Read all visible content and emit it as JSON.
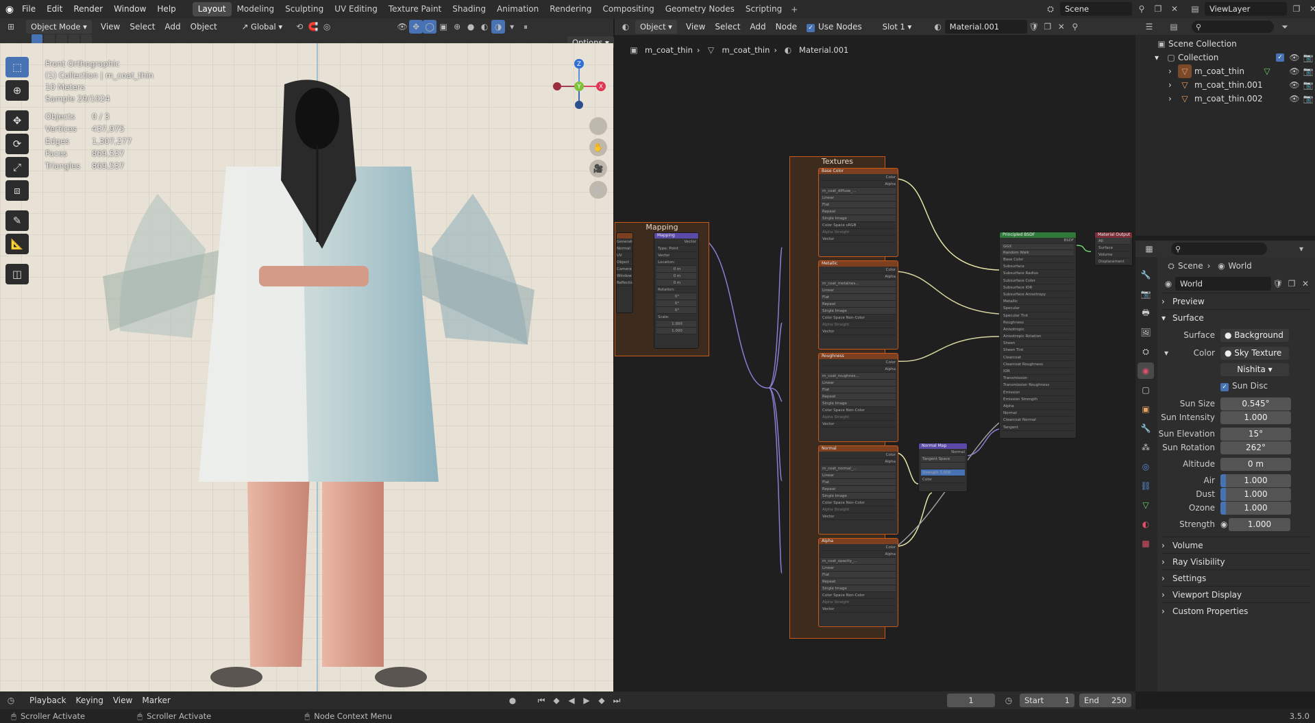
{
  "menu": [
    "File",
    "Edit",
    "Render",
    "Window",
    "Help"
  ],
  "workspaces": [
    "Layout",
    "Modeling",
    "Sculpting",
    "UV Editing",
    "Texture Paint",
    "Shading",
    "Animation",
    "Rendering",
    "Compositing",
    "Geometry Nodes",
    "Scripting"
  ],
  "active_workspace": "Layout",
  "scene_name": "Scene",
  "view_layer": "ViewLayer",
  "viewport_header": {
    "mode": "Object Mode",
    "menus": [
      "View",
      "Select",
      "Add",
      "Object"
    ],
    "transform": "Global",
    "options": "Options"
  },
  "viewport_overlay": {
    "view_name": "Front Orthographic",
    "collection": "(1) Collection | m_coat_thin",
    "scale": "10 Meters",
    "sample": "Sample 29/1024",
    "stats": [
      {
        "label": "Objects",
        "value": "0 / 3"
      },
      {
        "label": "Vertices",
        "value": "437,975"
      },
      {
        "label": "Edges",
        "value": "1,307,277"
      },
      {
        "label": "Faces",
        "value": "869,537"
      },
      {
        "label": "Triangles",
        "value": "869,537"
      }
    ]
  },
  "gizmo": {
    "z": "Z",
    "y": "Y",
    "x": "X"
  },
  "node_header": {
    "type": "Object",
    "menus": [
      "View",
      "Select",
      "Add",
      "Node"
    ],
    "use_nodes": "Use Nodes",
    "slot": "Slot 1",
    "material": "Material.001"
  },
  "breadcrumb": [
    "m_coat_thin",
    "m_coat_thin",
    "Material.001"
  ],
  "frames": {
    "textures": "Textures",
    "mapping": "Mapping"
  },
  "nodes": {
    "mapping": {
      "title": "Mapping",
      "type": "Type:",
      "type_value": "Point",
      "vector": "Vector",
      "location": "Location:",
      "rotation": "Rotation:",
      "scale": "Scale:",
      "loc": [
        "0 m",
        "0 m",
        "0 m"
      ],
      "rot": [
        "0°",
        "0°",
        "0°"
      ],
      "scl": [
        "1.000",
        "1.000",
        "1.000"
      ]
    },
    "texcoord_rows": [
      "Generated",
      "Normal",
      "UV",
      "Object",
      "Camera",
      "Window",
      "Reflection"
    ],
    "tex": [
      {
        "title": "Base Color",
        "image": "m_coat_diffuse_...",
        "space": "sRGB"
      },
      {
        "title": "Metallic",
        "image": "m_coat_metalnes...",
        "space": "Non-Color"
      },
      {
        "title": "Roughness",
        "image": "m_coat_roughnes...",
        "space": "Non-Color"
      },
      {
        "title": "Normal",
        "image": "m_coat_normal_...",
        "space": "Non-Color"
      },
      {
        "title": "Alpha",
        "image": "m_coat_opacity_...",
        "space": "Non-Color"
      }
    ],
    "tex_rows": [
      "Linear",
      "Flat",
      "Repeat",
      "Single Image"
    ],
    "tex_out": [
      "Color",
      "Alpha"
    ],
    "color_space": "Color Space",
    "alpha_label": "Alpha",
    "alpha_value": "Straight",
    "vector_label": "Vector",
    "bsdf": {
      "title": "Principled BSDF",
      "out": "BSDF",
      "dist": "GGX",
      "sss": "Random Walk",
      "rows": [
        "Base Color",
        "Subsurface",
        "Subsurface Radius",
        "Subsurface Color",
        "Subsurface IOR",
        "Subsurface Anisotropy",
        "Metallic",
        "Specular",
        "Specular Tint",
        "Roughness",
        "Anisotropic",
        "Anisotropic Rotation",
        "Sheen",
        "Sheen Tint",
        "Clearcoat",
        "Clearcoat Roughness",
        "IOR",
        "Transmission",
        "Transmission Roughness",
        "Emission",
        "Emission Strength",
        "Alpha",
        "Normal",
        "Clearcoat Normal",
        "Tangent"
      ]
    },
    "normal_map": {
      "title": "Normal Map",
      "out": "Normal",
      "space": "Tangent Space",
      "strength": "Strength",
      "strength_val": "1.000",
      "color": "Color"
    },
    "output": {
      "title": "Material Output",
      "target": "All",
      "rows": [
        "Surface",
        "Volume",
        "Displacement"
      ]
    }
  },
  "outliner": {
    "root": "Scene Collection",
    "collection": "Collection",
    "items": [
      "m_coat_thin",
      "m_coat_thin.001",
      "m_coat_thin.002"
    ]
  },
  "properties": {
    "scene": "Scene",
    "world": "World",
    "world_name": "World",
    "sections_top": [
      "Preview",
      "Surface"
    ],
    "surface": {
      "label": "Surface",
      "value": "Background"
    },
    "color": {
      "label": "Color",
      "value": "Sky Texture"
    },
    "sky_type": "Nishita",
    "sun_disc": "Sun Disc",
    "fields": [
      {
        "label": "Sun Size",
        "value": "0.545°"
      },
      {
        "label": "Sun Intensity",
        "value": "1.000"
      },
      {
        "label": "Sun Elevation",
        "value": "15°"
      },
      {
        "label": "Sun Rotation",
        "value": "262°"
      },
      {
        "label": "Altitude",
        "value": "0 m"
      },
      {
        "label": "Air",
        "value": "1.000"
      },
      {
        "label": "Dust",
        "value": "1.000"
      },
      {
        "label": "Ozone",
        "value": "1.000"
      }
    ],
    "strength": {
      "label": "Strength",
      "value": "1.000"
    },
    "sections_bottom": [
      "Volume",
      "Ray Visibility",
      "Settings",
      "Viewport Display",
      "Custom Properties"
    ]
  },
  "timeline": {
    "menus": [
      "Playback",
      "Keying",
      "View",
      "Marker"
    ],
    "frame": "1",
    "start_label": "Start",
    "start": "1",
    "end_label": "End",
    "end": "250"
  },
  "status": [
    "Scroller Activate",
    "Scroller Activate",
    "Node Context Menu"
  ],
  "version": "3.5.0"
}
